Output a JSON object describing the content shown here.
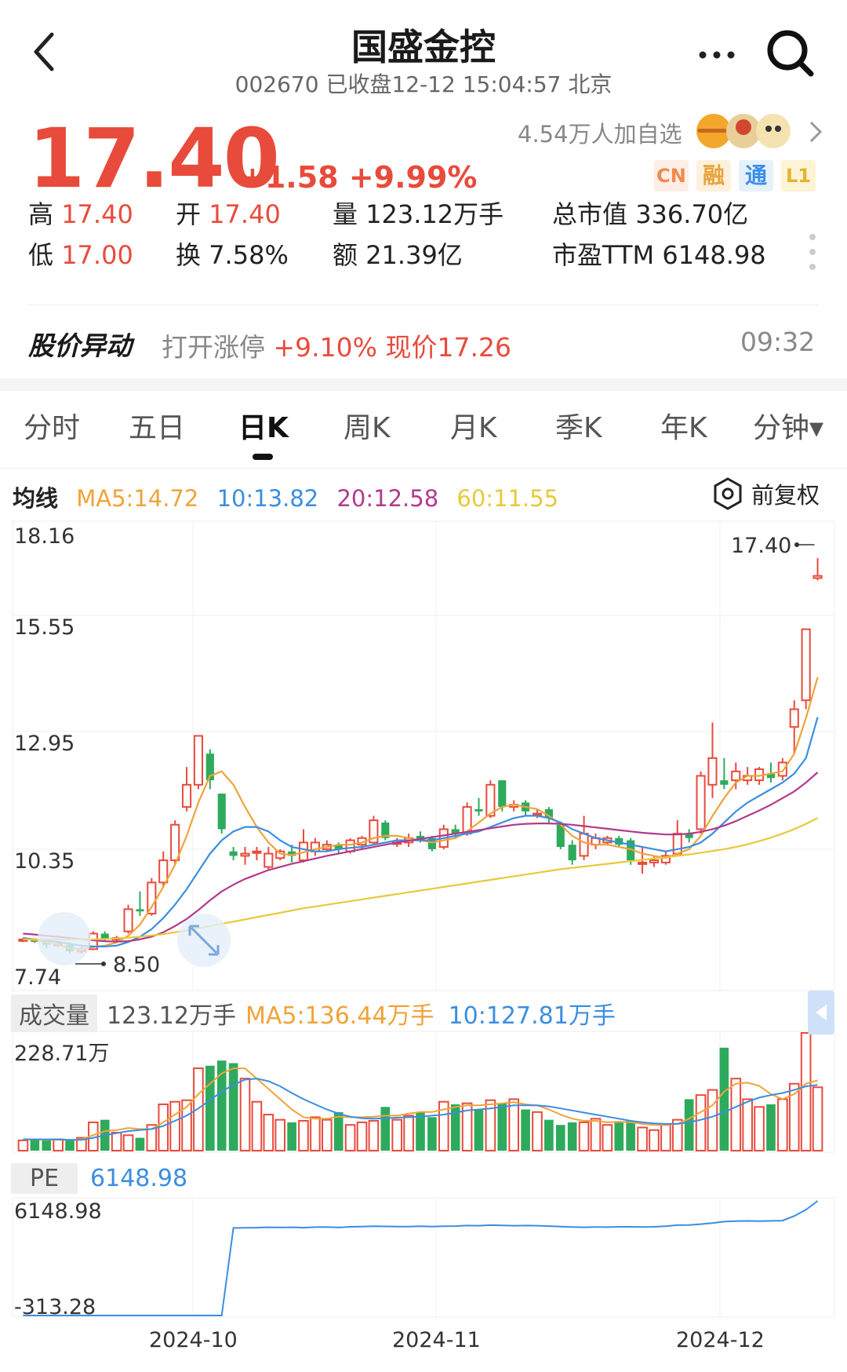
{
  "header": {
    "title": "国盛金控",
    "code": "002670",
    "status": "已收盘12-12 15:04:57 北京"
  },
  "quote": {
    "price": "17.40",
    "change": "+1.58 +9.99%",
    "watch": "4.54万人加自选",
    "tags": [
      "CN",
      "融",
      "通",
      "L1"
    ],
    "up_color": "#e84b3c"
  },
  "stats": {
    "high_label": "高",
    "high": "17.40",
    "low_label": "低",
    "low": "17.00",
    "open_label": "开",
    "open": "17.40",
    "turnover_label": "换",
    "turnover": "7.58%",
    "volume_label": "量",
    "volume": "123.12万手",
    "amount_label": "额",
    "amount": "21.39亿",
    "mcap_label": "总市值",
    "mcap": "336.70亿",
    "pe_label": "市盈TTM",
    "pe": "6148.98"
  },
  "alert": {
    "title": "股价异动",
    "text_grey": "打开涨停",
    "text_red": "+9.10% 现价17.26",
    "time": "09:32"
  },
  "tabs": [
    {
      "label": "分时"
    },
    {
      "label": "五日"
    },
    {
      "label": "日K"
    },
    {
      "label": "周K"
    },
    {
      "label": "月K"
    },
    {
      "label": "季K"
    },
    {
      "label": "年K"
    },
    {
      "label": "分钟▾"
    }
  ],
  "active_tab": "日K",
  "ma": {
    "label": "均线",
    "ma5": "MA5:14.72",
    "ma10": "10:13.82",
    "ma20": "20:12.58",
    "ma60": "60:11.55",
    "adjust": "前复权"
  },
  "volume": {
    "label": "成交量",
    "value": "123.12万手",
    "ma5": "MA5:136.44万手",
    "ma10": "10:127.81万手",
    "max_label": "228.71万"
  },
  "pe_panel": {
    "label": "PE",
    "value": "6148.98",
    "max_label": "6148.98",
    "min_label": "-313.28"
  },
  "colors": {
    "up": "#e84b3c",
    "down": "#2eaa5c",
    "ma5": "#f0a33a",
    "ma10": "#3b8ee0",
    "ma20": "#b23a8c",
    "ma60": "#e8c93a"
  },
  "chart_data": {
    "type": "candlestick",
    "title": "",
    "y_ticks": [
      "18.16",
      "15.55",
      "12.95",
      "10.35",
      "7.74"
    ],
    "ylim": [
      7.74,
      18.16
    ],
    "x_ticks": [
      "2024-10",
      "2024-11",
      "2024-12"
    ],
    "annotations": {
      "max": "17.40",
      "min": "8.50"
    },
    "candles": [
      [
        8.79,
        8.82,
        8.76,
        8.85
      ],
      [
        8.8,
        8.78,
        8.74,
        8.84
      ],
      [
        8.78,
        8.7,
        8.62,
        8.8
      ],
      [
        8.7,
        8.72,
        8.65,
        8.76
      ],
      [
        8.7,
        8.55,
        8.5,
        8.75
      ],
      [
        8.55,
        8.6,
        8.5,
        8.7
      ],
      [
        8.6,
        8.95,
        8.58,
        9.0
      ],
      [
        8.95,
        8.82,
        8.78,
        9.0
      ],
      [
        8.82,
        8.85,
        8.75,
        8.9
      ],
      [
        9.0,
        9.5,
        8.95,
        9.6
      ],
      [
        9.5,
        9.45,
        9.35,
        9.9
      ],
      [
        9.4,
        10.1,
        9.35,
        10.2
      ],
      [
        10.1,
        10.6,
        10.0,
        10.8
      ],
      [
        10.6,
        11.4,
        10.5,
        11.5
      ],
      [
        11.8,
        12.3,
        11.7,
        12.7
      ],
      [
        12.3,
        13.4,
        12.2,
        13.4
      ],
      [
        13.0,
        12.4,
        12.2,
        13.1
      ],
      [
        12.1,
        11.3,
        11.2,
        12.1
      ],
      [
        10.8,
        10.7,
        10.6,
        10.9
      ],
      [
        10.7,
        10.75,
        10.5,
        10.9
      ],
      [
        10.8,
        10.8,
        10.6,
        10.9
      ],
      [
        10.45,
        10.75,
        10.4,
        10.9
      ],
      [
        10.65,
        10.8,
        10.6,
        10.85
      ],
      [
        10.8,
        10.7,
        10.55,
        10.95
      ],
      [
        10.6,
        11.0,
        10.55,
        11.3
      ],
      [
        10.8,
        11.0,
        10.7,
        11.1
      ],
      [
        10.85,
        10.95,
        10.8,
        11.05
      ],
      [
        10.95,
        10.85,
        10.75,
        11.0
      ],
      [
        10.8,
        11.05,
        10.75,
        11.1
      ],
      [
        10.95,
        11.1,
        10.85,
        11.15
      ],
      [
        11.0,
        11.5,
        10.95,
        11.6
      ],
      [
        11.45,
        11.1,
        11.05,
        11.5
      ],
      [
        11.0,
        11.0,
        10.9,
        11.1
      ],
      [
        11.0,
        11.1,
        10.9,
        11.2
      ],
      [
        11.15,
        11.05,
        11.0,
        11.25
      ],
      [
        11.1,
        10.85,
        10.8,
        11.15
      ],
      [
        10.9,
        11.3,
        10.85,
        11.4
      ],
      [
        11.3,
        11.2,
        11.1,
        11.4
      ],
      [
        11.2,
        11.8,
        11.15,
        11.9
      ],
      [
        11.75,
        11.7,
        11.6,
        12.0
      ],
      [
        11.6,
        12.3,
        11.55,
        12.4
      ],
      [
        12.4,
        11.8,
        11.7,
        12.4
      ],
      [
        11.8,
        11.85,
        11.7,
        11.95
      ],
      [
        11.9,
        11.7,
        11.6,
        11.95
      ],
      [
        11.65,
        11.65,
        11.55,
        11.75
      ],
      [
        11.75,
        11.55,
        11.45,
        11.8
      ],
      [
        11.4,
        10.9,
        10.85,
        11.45
      ],
      [
        10.95,
        10.6,
        10.5,
        11.05
      ],
      [
        10.7,
        11.2,
        10.6,
        11.6
      ],
      [
        10.95,
        11.1,
        10.85,
        11.2
      ],
      [
        11.0,
        11.1,
        10.95,
        11.15
      ],
      [
        11.1,
        10.95,
        10.9,
        11.15
      ],
      [
        11.05,
        10.6,
        10.5,
        11.1
      ],
      [
        10.55,
        10.55,
        10.3,
        10.9
      ],
      [
        10.55,
        10.6,
        10.45,
        10.7
      ],
      [
        10.55,
        10.7,
        10.5,
        10.8
      ],
      [
        10.75,
        11.2,
        10.7,
        11.5
      ],
      [
        11.2,
        11.1,
        11.0,
        11.3
      ],
      [
        11.3,
        12.5,
        11.2,
        12.6
      ],
      [
        12.3,
        12.9,
        12.0,
        13.7
      ],
      [
        12.4,
        12.3,
        12.2,
        12.9
      ],
      [
        12.4,
        12.6,
        12.2,
        12.8
      ],
      [
        12.4,
        12.5,
        12.3,
        12.7
      ],
      [
        12.4,
        12.65,
        12.3,
        12.7
      ],
      [
        12.55,
        12.45,
        12.35,
        12.8
      ],
      [
        12.5,
        12.8,
        12.4,
        12.9
      ],
      [
        13.6,
        14.0,
        13.0,
        14.2
      ],
      [
        14.2,
        15.8,
        14.0,
        15.8
      ],
      [
        16.95,
        17.0,
        16.9,
        17.4
      ]
    ],
    "ma_series": [
      {
        "name": "MA5",
        "color": "#f0a33a",
        "values": [
          8.85,
          8.8,
          8.76,
          8.7,
          8.62,
          8.6,
          8.65,
          8.68,
          8.75,
          8.9,
          9.15,
          9.55,
          10.0,
          10.5,
          11.15,
          11.9,
          12.5,
          12.6,
          12.3,
          11.8,
          11.35,
          11.0,
          10.75,
          10.72,
          10.78,
          10.85,
          10.9,
          10.95,
          10.95,
          11.0,
          11.1,
          11.15,
          11.15,
          11.1,
          11.05,
          11.0,
          11.05,
          11.1,
          11.25,
          11.45,
          11.65,
          11.8,
          11.85,
          11.8,
          11.75,
          11.6,
          11.4,
          11.15,
          11.0,
          10.95,
          10.95,
          10.9,
          10.85,
          10.75,
          10.7,
          10.65,
          10.75,
          10.85,
          11.15,
          11.6,
          12.0,
          12.35,
          12.5,
          12.5,
          12.55,
          12.6,
          13.0,
          13.8,
          14.72
        ]
      },
      {
        "name": "MA10",
        "color": "#3b8ee0",
        "values": [
          8.85,
          8.82,
          8.8,
          8.76,
          8.72,
          8.68,
          8.66,
          8.66,
          8.68,
          8.76,
          8.88,
          9.05,
          9.3,
          9.6,
          9.95,
          10.35,
          10.75,
          11.05,
          11.25,
          11.35,
          11.35,
          11.25,
          11.05,
          10.9,
          10.85,
          10.8,
          10.8,
          10.85,
          10.88,
          10.9,
          10.95,
          11.0,
          11.05,
          11.05,
          11.05,
          11.05,
          11.1,
          11.15,
          11.2,
          11.25,
          11.35,
          11.45,
          11.55,
          11.6,
          11.6,
          11.55,
          11.45,
          11.3,
          11.2,
          11.1,
          11.05,
          11.0,
          10.95,
          10.9,
          10.85,
          10.8,
          10.85,
          10.9,
          11.0,
          11.2,
          11.45,
          11.7,
          11.9,
          12.05,
          12.2,
          12.35,
          12.55,
          12.9,
          13.82
        ]
      },
      {
        "name": "MA20",
        "color": "#b23a8c",
        "values": [
          8.95,
          8.93,
          8.9,
          8.88,
          8.85,
          8.82,
          8.8,
          8.78,
          8.77,
          8.78,
          8.82,
          8.88,
          8.98,
          9.12,
          9.28,
          9.48,
          9.7,
          9.9,
          10.05,
          10.18,
          10.28,
          10.38,
          10.45,
          10.52,
          10.58,
          10.64,
          10.7,
          10.75,
          10.8,
          10.85,
          10.9,
          10.95,
          11.0,
          11.04,
          11.08,
          11.12,
          11.16,
          11.2,
          11.24,
          11.28,
          11.32,
          11.36,
          11.4,
          11.42,
          11.43,
          11.43,
          11.42,
          11.4,
          11.37,
          11.34,
          11.31,
          11.28,
          11.25,
          11.22,
          11.2,
          11.18,
          11.18,
          11.2,
          11.24,
          11.3,
          11.38,
          11.48,
          11.6,
          11.72,
          11.85,
          12.0,
          12.15,
          12.35,
          12.58
        ]
      },
      {
        "name": "MA60",
        "color": "#e8c93a",
        "values": [
          8.82,
          8.82,
          8.82,
          8.82,
          8.82,
          8.82,
          8.82,
          8.83,
          8.84,
          8.86,
          8.88,
          8.91,
          8.94,
          8.98,
          9.02,
          9.07,
          9.12,
          9.17,
          9.22,
          9.27,
          9.32,
          9.37,
          9.42,
          9.47,
          9.52,
          9.56,
          9.6,
          9.64,
          9.68,
          9.72,
          9.76,
          9.8,
          9.84,
          9.88,
          9.92,
          9.96,
          10.0,
          10.04,
          10.08,
          10.12,
          10.16,
          10.2,
          10.24,
          10.28,
          10.32,
          10.36,
          10.4,
          10.43,
          10.46,
          10.49,
          10.52,
          10.55,
          10.58,
          10.61,
          10.64,
          10.67,
          10.7,
          10.73,
          10.77,
          10.81,
          10.85,
          10.9,
          10.96,
          11.03,
          11.11,
          11.2,
          11.3,
          11.42,
          11.55
        ]
      }
    ],
    "volume": [
      20,
      22,
      20,
      22,
      20,
      25,
      55,
      60,
      35,
      30,
      25,
      50,
      90,
      95,
      98,
      160,
      165,
      175,
      170,
      140,
      95,
      70,
      60,
      55,
      58,
      65,
      60,
      75,
      50,
      55,
      58,
      85,
      60,
      68,
      75,
      65,
      95,
      90,
      92,
      80,
      98,
      92,
      100,
      80,
      75,
      60,
      50,
      55,
      55,
      62,
      50,
      55,
      58,
      45,
      40,
      50,
      60,
      100,
      108,
      118,
      200,
      140,
      100,
      85,
      90,
      100,
      130,
      228.71,
      123.12
    ],
    "vol_ma": [
      {
        "name": "MA5",
        "color": "#f0a33a",
        "values": [
          22,
          22,
          21,
          21,
          21,
          22,
          30,
          38,
          40,
          44,
          42,
          42,
          55,
          70,
          85,
          110,
          130,
          150,
          160,
          160,
          140,
          120,
          100,
          80,
          65,
          62,
          62,
          66,
          65,
          65,
          66,
          68,
          68,
          72,
          75,
          75,
          80,
          85,
          88,
          88,
          90,
          92,
          94,
          90,
          88,
          80,
          70,
          62,
          58,
          58,
          55,
          56,
          55,
          52,
          50,
          50,
          52,
          62,
          75,
          88,
          115,
          130,
          132,
          126,
          110,
          100,
          110,
          130,
          136.44
        ]
      },
      {
        "name": "MA10",
        "color": "#3b8ee0",
        "values": [
          22,
          22,
          22,
          22,
          21,
          21,
          25,
          30,
          34,
          38,
          40,
          42,
          48,
          58,
          68,
          82,
          98,
          115,
          128,
          138,
          140,
          135,
          125,
          112,
          100,
          90,
          80,
          72,
          66,
          63,
          62,
          63,
          64,
          65,
          66,
          68,
          70,
          74,
          78,
          80,
          82,
          85,
          88,
          88,
          88,
          86,
          82,
          78,
          74,
          70,
          66,
          62,
          58,
          55,
          53,
          52,
          52,
          55,
          60,
          66,
          75,
          85,
          95,
          103,
          108,
          112,
          118,
          125,
          127.81
        ]
      }
    ],
    "pe": [
      -313,
      -313,
      -313,
      -313,
      -313,
      -313,
      -313,
      -313,
      -313,
      -313,
      -313,
      -313,
      -313,
      -313,
      -313,
      -313,
      -313,
      -313,
      4620,
      4630,
      4640,
      4660,
      4650,
      4660,
      4640,
      4670,
      4680,
      4650,
      4690,
      4700,
      4720,
      4710,
      4700,
      4700,
      4720,
      4700,
      4720,
      4730,
      4760,
      4750,
      4780,
      4770,
      4750,
      4760,
      4750,
      4730,
      4700,
      4680,
      4660,
      4680,
      4670,
      4690,
      4690,
      4680,
      4690,
      4720,
      4780,
      4790,
      4840,
      4900,
      4980,
      5010,
      5020,
      5010,
      5020,
      5040,
      5300,
      5650,
      6148.98
    ]
  }
}
